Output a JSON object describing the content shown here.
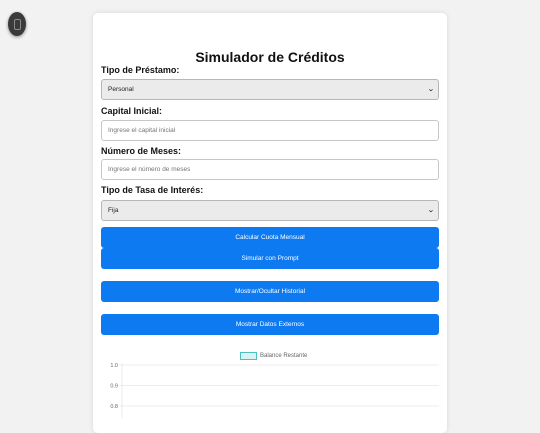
{
  "app": {
    "title": "Simulador de Créditos"
  },
  "form": {
    "loan_type": {
      "label": "Tipo de Préstamo:",
      "value": "Personal"
    },
    "capital": {
      "label": "Capital Inicial:",
      "placeholder": "Ingrese el capital inicial"
    },
    "months": {
      "label": "Número de Meses:",
      "placeholder": "Ingrese el número de meses"
    },
    "rate_type": {
      "label": "Tipo de Tasa de Interés:",
      "value": "Fija"
    }
  },
  "buttons": {
    "calculate": "Calcular Cuota Mensual",
    "prompt": "Simular con Prompt",
    "history": "Mostrar/Ocultar Historial",
    "external": "Mostrar Datos Externos"
  },
  "chart_data": {
    "type": "line",
    "series": [
      {
        "name": "Balance Restante",
        "values": []
      }
    ],
    "y_ticks": [
      "1.0",
      "0.9",
      "0.8"
    ],
    "ylim": [
      0,
      1.0
    ],
    "grid": true,
    "legend": "top"
  },
  "colors": {
    "accent": "#0d7af2",
    "series_border": "#4bc0c0"
  },
  "icons": {
    "floating": "mobile-icon",
    "dropdown": "chevron-down-icon"
  }
}
